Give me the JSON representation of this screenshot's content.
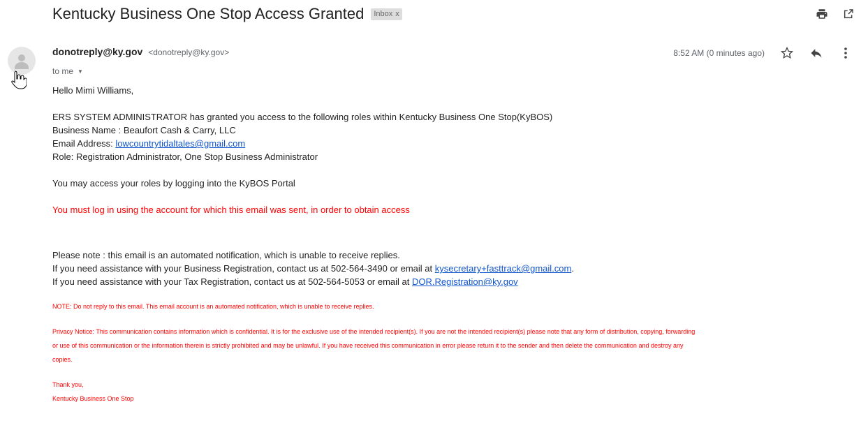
{
  "email": {
    "subject": "Kentucky Business One Stop Access Granted",
    "label": "Inbox",
    "label_close": "x",
    "sender_name": "donotreply@ky.gov",
    "sender_email": "<donotreply@ky.gov>",
    "recipient": "to me",
    "timestamp": "8:52 AM (0 minutes ago)",
    "icons": {
      "print": "print-icon",
      "popout": "open-in-new-window-icon",
      "star": "star-icon",
      "reply": "reply-icon",
      "more": "more-vertical-icon",
      "avatar": "person-avatar-icon",
      "cursor": "hand-pointer-cursor-icon",
      "caret": "caret-down-icon"
    }
  },
  "body": {
    "greeting": "Hello Mimi Williams,",
    "line1": "ERS SYSTEM ADMINISTRATOR has granted you access to the following roles within Kentucky Business One Stop(KyBOS)",
    "business_name": "Business Name : Beaufort Cash & Carry, LLC",
    "email_label": "Email Address: ",
    "email_value": "lowcountrytidaltales@gmail.com",
    "role": "Role: Registration Administrator, One Stop Business Administrator",
    "access_line": "You may access your roles by logging into the KyBOS Portal",
    "warning": "You must log in using the account for which this email was sent, in order to obtain access",
    "note1": "Please note : this email is an automated notification, which is unable to receive replies.",
    "note2_pre": "If you need assistance with your Business Registration, contact us at 502-564-3490 or email at ",
    "note2_link": "kysecretary+fasttrack@gmail.com",
    "note2_post": ".",
    "note3_pre": "If you need assistance with your Tax Registration, contact us at 502-564-5053 or email at ",
    "note3_link": "DOR.Registration@ky.gov",
    "footer_note": "NOTE: Do not reply to this email. This email account is an automated notification, which is unable to receive replies.",
    "privacy_line1": "Privacy Notice: This communication contains information which is confidential. It is for the exclusive use of the intended recipient(s). If you are not the intended recipient(s) please note that any form of distribution, copying, forwarding",
    "privacy_line2": "or use of this communication or the information therein is strictly prohibited and may be unlawful. If you have received this communication in error please return it to the sender and then delete the communication and destroy any",
    "privacy_line3": "copies.",
    "thanks": "Thank you,",
    "signature": "Kentucky Business One Stop"
  },
  "colors": {
    "text": "#222222",
    "muted": "#5f6368",
    "link": "#1155cc",
    "warning": "#ff0000",
    "chip_bg": "#dddddd"
  }
}
